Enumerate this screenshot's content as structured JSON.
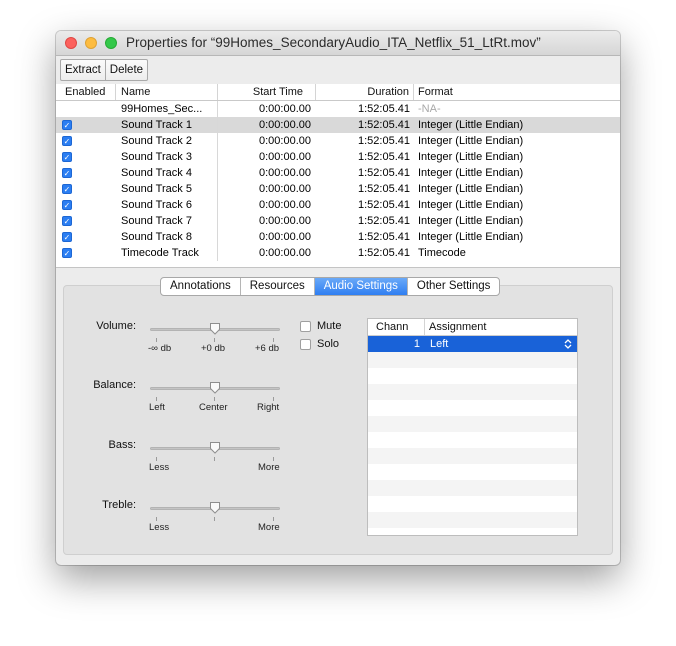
{
  "window": {
    "title": "Properties for “99Homes_SecondaryAudio_ITA_Netflix_51_LtRt.mov”"
  },
  "toolbar": {
    "extract_label": "Extract",
    "delete_label": "Delete"
  },
  "tracks": {
    "columns": [
      "Enabled",
      "Name",
      "Start Time",
      "Duration",
      "Format"
    ],
    "rows": [
      {
        "enabled": false,
        "name": "99Homes_Sec...",
        "start": "0:00:00.00",
        "duration": "1:52:05.41",
        "format": "-NA-"
      },
      {
        "enabled": true,
        "name": "Sound Track 1",
        "start": "0:00:00.00",
        "duration": "1:52:05.41",
        "format": "Integer (Little Endian)"
      },
      {
        "enabled": true,
        "name": "Sound Track 2",
        "start": "0:00:00.00",
        "duration": "1:52:05.41",
        "format": "Integer (Little Endian)"
      },
      {
        "enabled": true,
        "name": "Sound Track 3",
        "start": "0:00:00.00",
        "duration": "1:52:05.41",
        "format": "Integer (Little Endian)"
      },
      {
        "enabled": true,
        "name": "Sound Track 4",
        "start": "0:00:00.00",
        "duration": "1:52:05.41",
        "format": "Integer (Little Endian)"
      },
      {
        "enabled": true,
        "name": "Sound Track 5",
        "start": "0:00:00.00",
        "duration": "1:52:05.41",
        "format": "Integer (Little Endian)"
      },
      {
        "enabled": true,
        "name": "Sound Track 6",
        "start": "0:00:00.00",
        "duration": "1:52:05.41",
        "format": "Integer (Little Endian)"
      },
      {
        "enabled": true,
        "name": "Sound Track 7",
        "start": "0:00:00.00",
        "duration": "1:52:05.41",
        "format": "Integer (Little Endian)"
      },
      {
        "enabled": true,
        "name": "Sound Track 8",
        "start": "0:00:00.00",
        "duration": "1:52:05.41",
        "format": "Integer (Little Endian)"
      },
      {
        "enabled": true,
        "name": "Timecode Track",
        "start": "0:00:00.00",
        "duration": "1:52:05.41",
        "format": "Timecode"
      }
    ]
  },
  "tabs": [
    "Annotations",
    "Resources",
    "Audio Settings",
    "Other Settings"
  ],
  "audio": {
    "volume": {
      "label": "Volume:",
      "min": "-∞ db",
      "mid": "+0 db",
      "max": "+6 db",
      "level": 0.5
    },
    "balance": {
      "label": "Balance:",
      "min": "Left",
      "mid": "Center",
      "max": "Right",
      "level": 0.5
    },
    "bass": {
      "label": "Bass:",
      "min": "Less",
      "max": "More",
      "level": 0.5
    },
    "treble": {
      "label": "Treble:",
      "min": "Less",
      "max": "More",
      "level": 0.5
    },
    "mute_label": "Mute",
    "solo_label": "Solo"
  },
  "assignment": {
    "columns": [
      "Chann",
      "Assignment"
    ],
    "rows": [
      {
        "channel": "1",
        "assignment": "Left"
      }
    ]
  },
  "colors": {
    "accent": "#2f7ef1",
    "selection": "#1962d8",
    "checkbox": "#2b7ef2"
  },
  "icons": {
    "checkbox": "checkmark-icon",
    "popup": "updown-chevron-icon",
    "knob": "slider-knob-icon"
  }
}
